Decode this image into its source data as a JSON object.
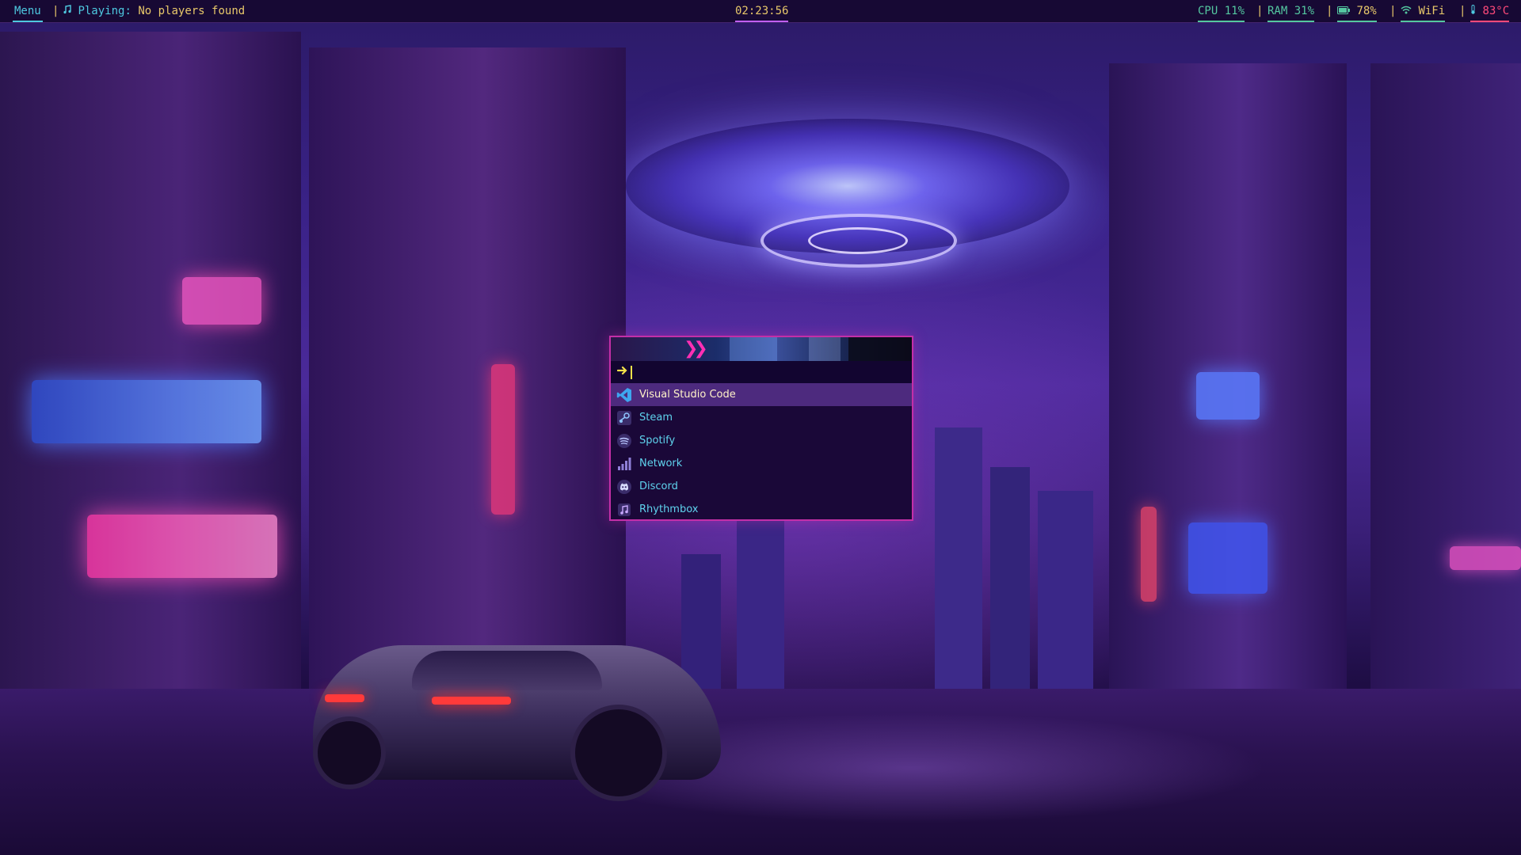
{
  "topbar": {
    "menu_label": "Menu",
    "separator": "|",
    "player_icon": "music-note-icon",
    "player_label": "Playing:",
    "player_status": "No players found",
    "clock": "02:23:56",
    "cpu": "CPU 11%",
    "ram": "RAM 31%",
    "battery_icon": "battery-icon",
    "battery": "78%",
    "wifi_icon": "wifi-icon",
    "wifi": "WiFi",
    "temp_icon": "thermometer-icon",
    "temperature": "83°C"
  },
  "launcher": {
    "prompt_icon": "arrow-right-icon",
    "search_value": "",
    "items": [
      {
        "label": "Visual Studio Code",
        "icon": "vscode-icon",
        "selected": true
      },
      {
        "label": "Steam",
        "icon": "steam-icon",
        "selected": false
      },
      {
        "label": "Spotify",
        "icon": "spotify-icon",
        "selected": false
      },
      {
        "label": "Network",
        "icon": "network-signal-icon",
        "selected": false
      },
      {
        "label": "Discord",
        "icon": "discord-icon",
        "selected": false
      },
      {
        "label": "Rhythmbox",
        "icon": "rhythmbox-icon",
        "selected": false
      }
    ]
  },
  "colors": {
    "accent_cyan": "#4ec9e0",
    "accent_yellow": "#e8c86a",
    "accent_green": "#54c7a0",
    "accent_pink": "#ff4a7a",
    "launcher_border": "#c32fa8",
    "launcher_bg": "#1a0838",
    "selection_bg": "#4d2a7e"
  }
}
